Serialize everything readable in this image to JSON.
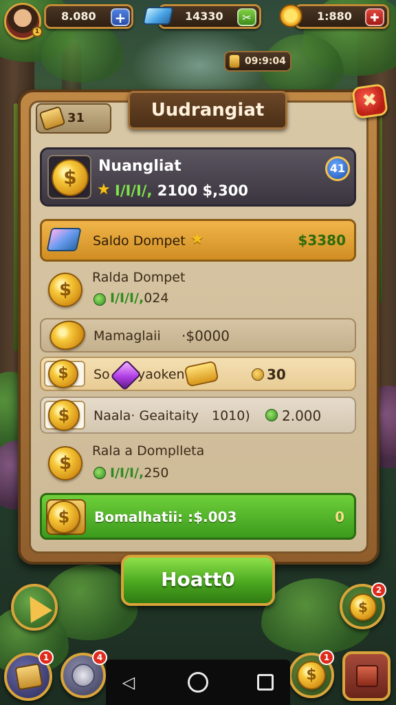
{
  "topbar": {
    "coins_value": "8.080",
    "coins_plus": "+",
    "gems_value": "14330",
    "gems_action": "✂",
    "energy_value": "1:880",
    "energy_action": "✚",
    "avatar_level": "1",
    "timer": "09:9:04"
  },
  "panel": {
    "title": "Uudrangiat",
    "tag_value": "31",
    "close_symbol": "✖"
  },
  "hero_card": {
    "name": "Nuangliat",
    "stars_text": "★",
    "sub_green": "I/I/I/,",
    "sub_value": "2100 $,300",
    "badge": "41"
  },
  "rows": [
    {
      "label": "Saldo Dompet",
      "amount": "$3380"
    },
    {
      "label": "Ralda Dompet",
      "sub_green": "I/I/I/,",
      "sub_value": "024"
    },
    {
      "label": "Mamaglaii",
      "amount": "·$0000"
    },
    {
      "label_prefix": "So",
      "label_suffix": "yaoken",
      "amount": "30"
    },
    {
      "label": "Naala· Geaitaity",
      "mid": "1010)",
      "amount": "2.000"
    },
    {
      "label": "Rala a Domplleta",
      "sub_green": "I/I/I/,",
      "sub_value": "250"
    },
    {
      "label": "Bomalhatii: :$.003",
      "amount": "0"
    }
  ],
  "main_button": {
    "label": "Hoatt0"
  },
  "side_buttons": {
    "left_badge": "",
    "right_badge": "2"
  },
  "bottom_buttons": {
    "inventory_badge": "1",
    "compass_badge": "4",
    "shop_badge": "1"
  },
  "colors": {
    "accent_gold": "#d9a43a",
    "panel_wood": "#c08845",
    "row_orange": "#f0b54a",
    "row_green": "#6fd03a",
    "text_green": "#2f8b1f"
  }
}
